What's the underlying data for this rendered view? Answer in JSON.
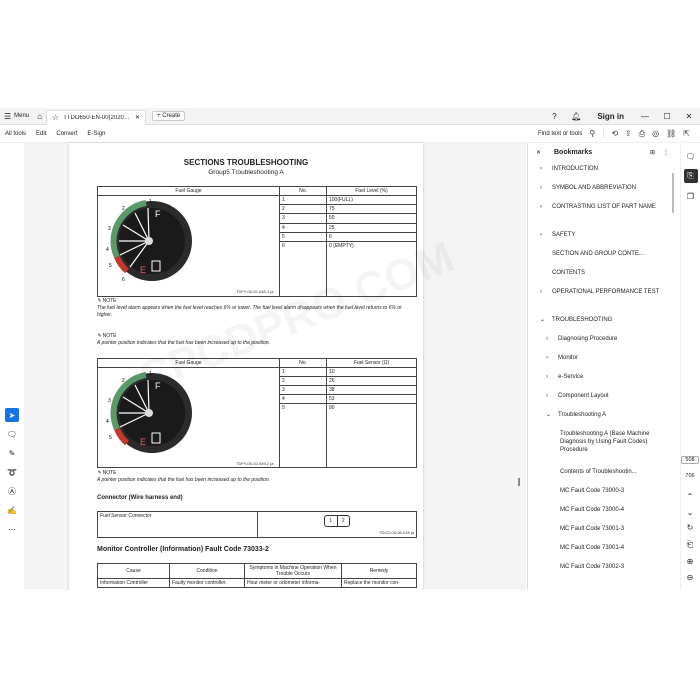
{
  "titlebar": {
    "menu_label": "Menu",
    "tab_title": "TTDO650-EN-00(20200I...",
    "new_tab_label": "Create",
    "sign_in": "Sign in"
  },
  "toolbar": {
    "items": [
      "All tools",
      "Edit",
      "Convert",
      "E-Sign"
    ],
    "find_label": "Find text or tools"
  },
  "doc": {
    "title": "SECTIONS TROUBLESHOOTING",
    "subtitle": "Group5 Troubleshooting A",
    "table1": {
      "headers": [
        "Fuel Gauge",
        "No.",
        "Fuel Level (%)"
      ],
      "rows": [
        [
          "1",
          "100(FULL)"
        ],
        [
          "2",
          "75"
        ],
        [
          "3",
          "50"
        ],
        [
          "4",
          "25"
        ],
        [
          "5",
          "6"
        ],
        [
          "6",
          "0 (EMPTY)"
        ]
      ],
      "figure_id": "TDFY-05-02-048-1 ja"
    },
    "note1_label": "NOTE",
    "note1_text": "The fuel level alarm appears when the fuel level reaches 6% or lower. The fuel level alarm disappears when the fuel level returns to 6% or higher.",
    "note2_label": "NOTE",
    "note2_text": "A pointer position indicates that the fuel has been increased up to the position.",
    "table2": {
      "headers": [
        "Fuel Gauge",
        "No.",
        "Fuel Sensor (Ω)"
      ],
      "rows": [
        [
          "1",
          "10"
        ],
        [
          "2",
          "26"
        ],
        [
          "3",
          "38"
        ],
        [
          "4",
          "53"
        ],
        [
          "5",
          "90"
        ]
      ],
      "figure_id": "TDFY-05-02-049-2 ja"
    },
    "note3_label": "NOTE",
    "note3_text": "A pointer position indicates that the fuel has been increased up to the position.",
    "connector_heading": "Connector (Wire harness end)",
    "connector_name": "Fuel Sensor Connector",
    "connector_pins": [
      "1",
      "2"
    ],
    "connector_figure_id": "TDCD-05-06-015 ja",
    "fault_heading": "Monitor Controller (Information) Fault Code 73033-2",
    "fault_headers": [
      "Cause",
      "Condition",
      "Symptoms in Machine Operation When Trouble Occurs",
      "Remedy"
    ],
    "fault_row": [
      "Information Controller",
      "Faulty monitor controller.",
      "Hour meter or odometer informa-",
      "Replace the monitor con-"
    ],
    "gauge_labels": {
      "full": "F",
      "empty": "E"
    },
    "gauge1_numbers": [
      "1",
      "2",
      "3",
      "4",
      "5",
      "6"
    ],
    "gauge2_numbers": [
      "1",
      "2",
      "3",
      "4",
      "5"
    ]
  },
  "bookmarks": {
    "title": "Bookmarks",
    "items": [
      {
        "label": "INTRODUCTION",
        "chevron": "›"
      },
      {
        "label": "SYMBOL AND ABBREVIATION",
        "chevron": "›"
      },
      {
        "label": "CONTRASTING LIST OF PART NAME",
        "chevron": "›"
      },
      {
        "label": "SAFETY",
        "chevron": "›"
      },
      {
        "label": "SECTION AND GROUP CONTE...",
        "chevron": ""
      },
      {
        "label": "CONTENTS",
        "chevron": ""
      },
      {
        "label": "OPERATIONAL PERFORMANCE TEST",
        "chevron": "›"
      },
      {
        "label": "TROUBLESHOOTING",
        "chevron": "⌄"
      },
      {
        "label": "Diagnosing Procedure",
        "chevron": "›"
      },
      {
        "label": "Monitor",
        "chevron": "›"
      },
      {
        "label": "e-Service",
        "chevron": "›"
      },
      {
        "label": "Component Layout",
        "chevron": "›"
      },
      {
        "label": "Troubleshooting A",
        "chevron": "⌄"
      },
      {
        "label": "Troubleshooting A (Base Machine Diagnosis by Using Fault Codes) Procedure",
        "chevron": ""
      },
      {
        "label": "Contents of Troubleshootin...",
        "chevron": ""
      },
      {
        "label": "MC Fault Code 73000-3",
        "chevron": ""
      },
      {
        "label": "MC Fault Code 73000-4",
        "chevron": ""
      },
      {
        "label": "MC Fault Code 73001-3",
        "chevron": ""
      },
      {
        "label": "MC Fault Code 73001-4",
        "chevron": ""
      },
      {
        "label": "MC Fault Code 73002-3",
        "chevron": ""
      }
    ]
  },
  "pagenav": {
    "current": "508",
    "total": "706"
  },
  "watermark": "CPCDPRO.COM"
}
